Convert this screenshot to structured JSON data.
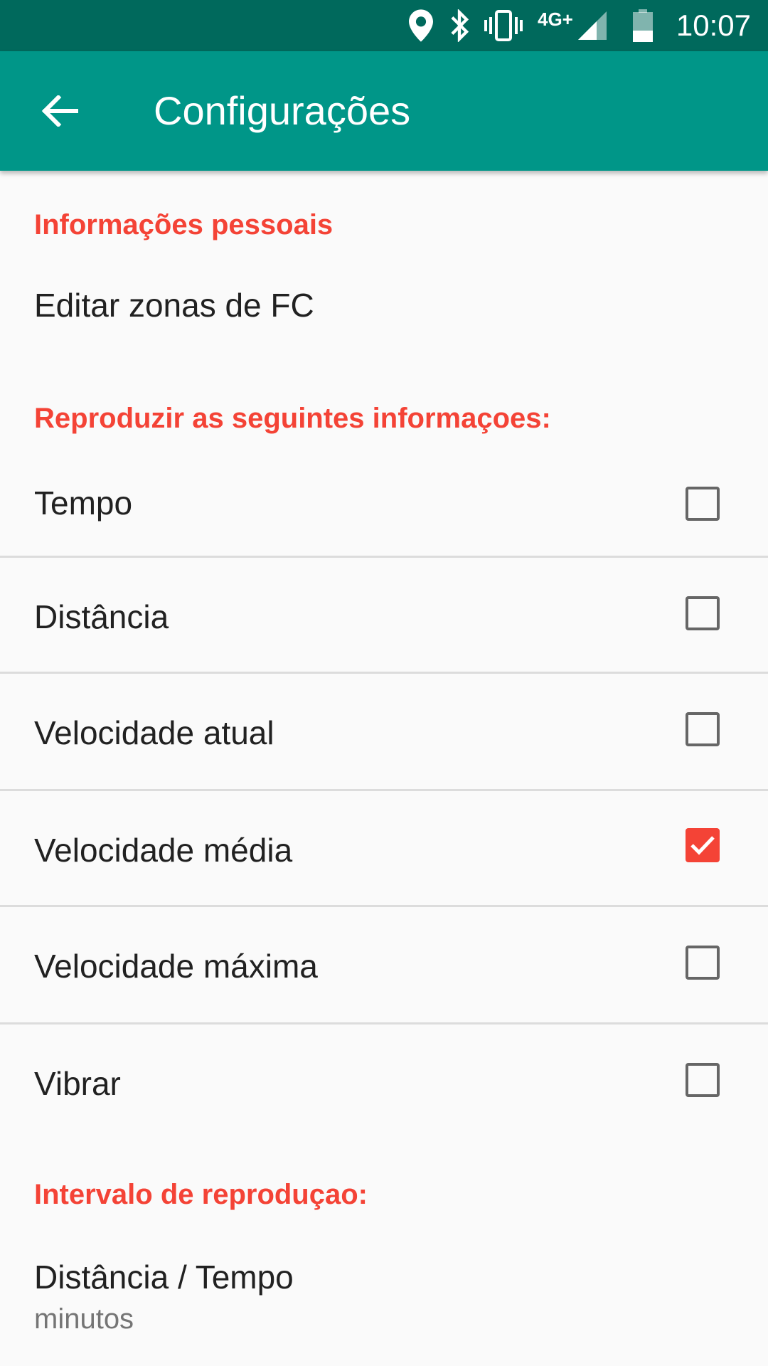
{
  "status_bar": {
    "time": "10:07",
    "network": "4G+",
    "icons": [
      "location-icon",
      "bluetooth-icon",
      "vibrate-icon",
      "signal-icon",
      "battery-icon"
    ]
  },
  "app_bar": {
    "title": "Configurações",
    "back_icon": "arrow-back-icon"
  },
  "sections": {
    "personal": {
      "header": "Informações pessoais",
      "items": [
        {
          "label": "Editar zonas de FC"
        }
      ]
    },
    "reproduce": {
      "header": "Reproduzir as seguintes informaçoes:",
      "items": [
        {
          "label": "Tempo",
          "checked": false
        },
        {
          "label": "Distância",
          "checked": false
        },
        {
          "label": "Velocidade atual",
          "checked": false
        },
        {
          "label": "Velocidade média",
          "checked": true
        },
        {
          "label": "Velocidade máxima",
          "checked": false
        },
        {
          "label": "Vibrar",
          "checked": false
        }
      ]
    },
    "interval": {
      "header": "Intervalo de reproduçao:",
      "items": [
        {
          "label": "Distância / Tempo",
          "summary": "minutos"
        }
      ]
    }
  },
  "colors": {
    "status_bar": "#00695c",
    "app_bar": "#009688",
    "accent": "#f44336",
    "background": "#fafafa"
  }
}
